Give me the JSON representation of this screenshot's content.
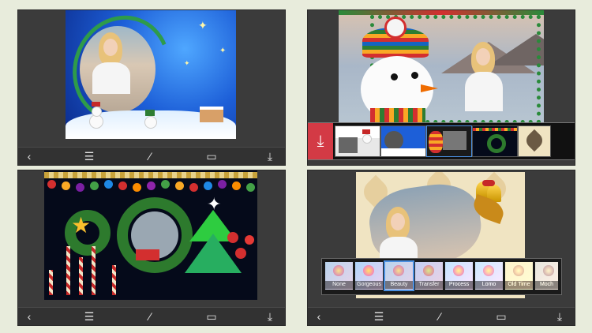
{
  "toolbar_icons": {
    "back": "chevron-left-icon",
    "list": "list-icon",
    "wand": "magic-wand-icon",
    "image": "image-icon",
    "download": "download-icon"
  },
  "filters": [
    {
      "label": "None"
    },
    {
      "label": "Gorgeous"
    },
    {
      "label": "Beauty",
      "selected": true
    },
    {
      "label": "Transfer"
    },
    {
      "label": "Process"
    },
    {
      "label": "Lomo"
    },
    {
      "label": "Old Time"
    },
    {
      "label": "Moch"
    }
  ],
  "colors": {
    "background": "#e8ecdc",
    "panel": "#3b3b3b",
    "accent_red": "#d33a45",
    "selection_blue": "#4a8fe0"
  }
}
